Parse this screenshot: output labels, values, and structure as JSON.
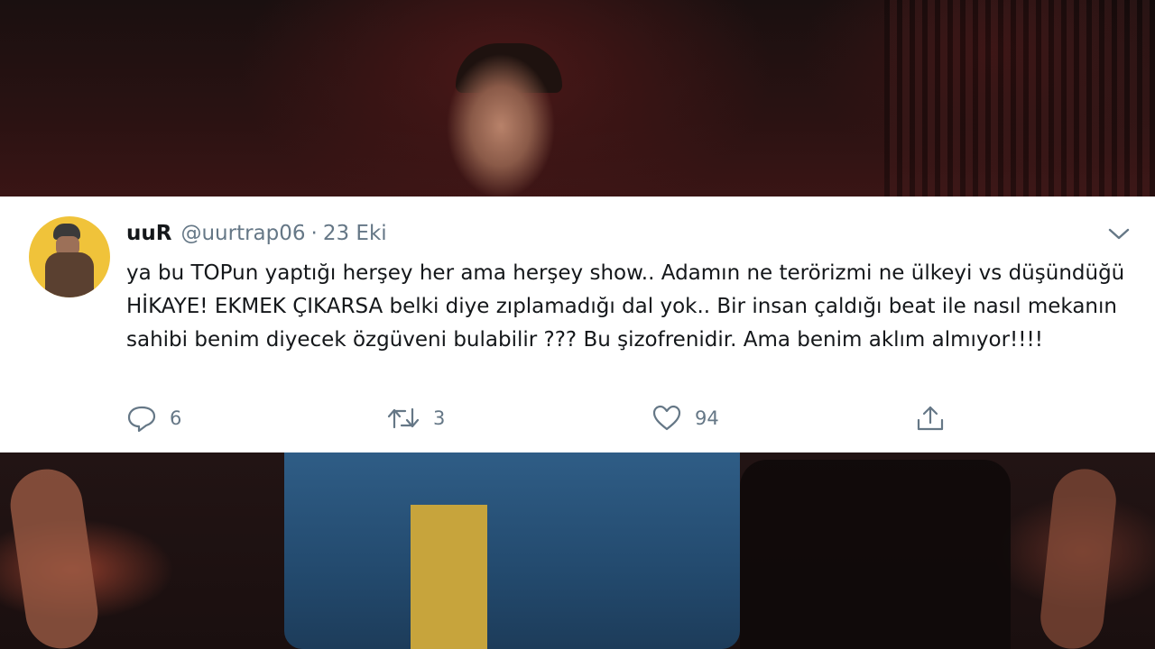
{
  "tweet": {
    "display_name": "uuR",
    "handle": "@uurtrap06",
    "separator": "·",
    "date": "23 Eki",
    "text": "ya bu TOPun yaptığı herşey her ama herşey show.. Adamın ne terörizmi ne ülkeyi vs düşündüğü HİKAYE! EKMEK ÇIKARSA belki diye zıplamadığı dal yok.. Bir insan çaldığı beat ile nasıl mekanın sahibi benim diyecek özgüveni bulabilir ??? Bu şizofrenidir. Ama benim aklım almıyor!!!!",
    "reply_count": "6",
    "retweet_count": "3",
    "like_count": "94",
    "icons": {
      "reply": "reply-icon",
      "retweet": "retweet-icon",
      "like": "heart-icon",
      "share": "share-icon",
      "menu": "chevron-down-icon"
    },
    "colors": {
      "name": "#14171a",
      "secondary": "#657786",
      "avatar_bg": "#f0c33a"
    }
  }
}
